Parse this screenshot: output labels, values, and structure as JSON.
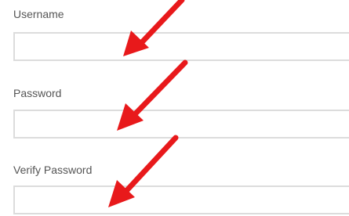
{
  "form": {
    "username": {
      "label": "Username",
      "value": "",
      "placeholder": ""
    },
    "password": {
      "label": "Password",
      "value": "",
      "placeholder": ""
    },
    "verify_password": {
      "label": "Verify Password",
      "value": "",
      "placeholder": ""
    }
  },
  "annotation": {
    "arrow_color": "#e8191b",
    "arrow_count": 3
  }
}
